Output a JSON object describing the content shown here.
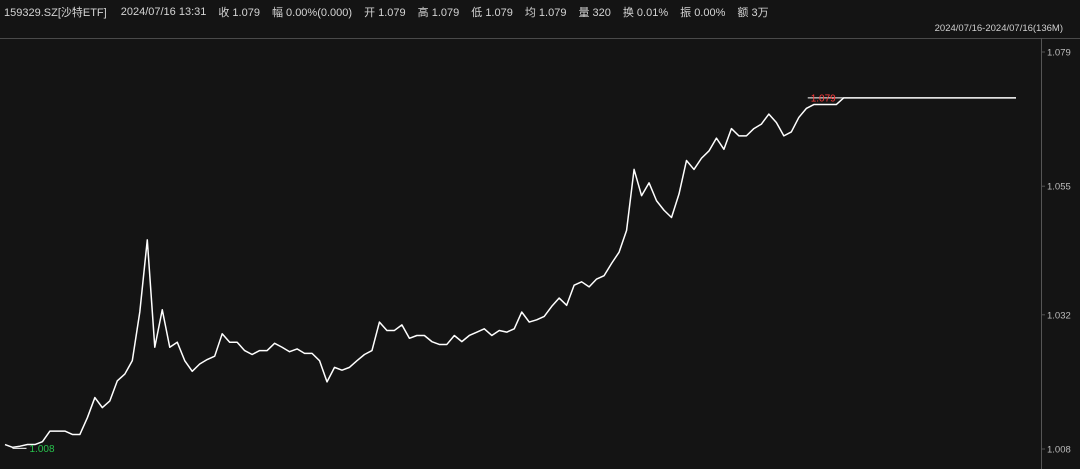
{
  "header": {
    "symbol": "159329.SZ[沙特ETF]",
    "datetime": "2024/07/16 13:31",
    "fields": [
      {
        "label": "收",
        "value": "1.079"
      },
      {
        "label": "幅",
        "value": "0.00%(0.000)"
      },
      {
        "label": "开",
        "value": "1.079"
      },
      {
        "label": "高",
        "value": "1.079"
      },
      {
        "label": "低",
        "value": "1.079"
      },
      {
        "label": "均",
        "value": "1.079"
      },
      {
        "label": "量",
        "value": "320"
      },
      {
        "label": "换",
        "value": "0.01%"
      },
      {
        "label": "振",
        "value": "0.00%"
      },
      {
        "label": "额",
        "value": "3万"
      }
    ],
    "range": "2024/07/16-2024/07/16(136M)"
  },
  "chart_data": {
    "type": "line",
    "title": "",
    "xlabel": "",
    "ylabel": "",
    "ylim": [
      1.008,
      1.079
    ],
    "yticks": [
      "1.079",
      "1.055",
      "1.032",
      "1.008"
    ],
    "grid": false,
    "max_label": {
      "text": "1.079",
      "color": "#ff3b3b"
    },
    "min_label": {
      "text": "1.008",
      "color": "#27c24c"
    },
    "colors": {
      "line": "#ffffff",
      "background": "#141414",
      "axis": "#555555",
      "tick_text": "#bdbdbd"
    },
    "series": [
      {
        "values": [
          1.0088,
          1.0083,
          1.0085,
          1.0088,
          1.0088,
          1.0093,
          1.0112,
          1.0112,
          1.0112,
          1.0106,
          1.0106,
          1.0136,
          1.0172,
          1.0154,
          1.0166,
          1.0202,
          1.0214,
          1.0238,
          1.0325,
          1.0454,
          1.0262,
          1.0329,
          1.0262,
          1.0271,
          1.0238,
          1.0219,
          1.0232,
          1.024,
          1.0246,
          1.0286,
          1.0271,
          1.0271,
          1.0256,
          1.0249,
          1.0256,
          1.0256,
          1.0269,
          1.0262,
          1.0254,
          1.0259,
          1.0251,
          1.0251,
          1.0238,
          1.02,
          1.0226,
          1.0221,
          1.0226,
          1.0238,
          1.0249,
          1.0256,
          1.0307,
          1.0292,
          1.0292,
          1.0302,
          1.0278,
          1.0283,
          1.0283,
          1.0272,
          1.0267,
          1.0267,
          1.0283,
          1.0272,
          1.0283,
          1.0289,
          1.0295,
          1.0283,
          1.0292,
          1.0289,
          1.0295,
          1.0325,
          1.0307,
          1.0311,
          1.0317,
          1.0335,
          1.035,
          1.0337,
          1.0373,
          1.0379,
          1.037,
          1.0384,
          1.039,
          1.0412,
          1.0432,
          1.0471,
          1.058,
          1.0533,
          1.0556,
          1.0524,
          1.0507,
          1.0494,
          1.0536,
          1.0596,
          1.058,
          1.06,
          1.0613,
          1.0636,
          1.0616,
          1.0653,
          1.064,
          1.064,
          1.0653,
          1.0661,
          1.0679,
          1.0664,
          1.064,
          1.0647,
          1.0673,
          1.0689,
          1.0696,
          1.0696,
          1.0696,
          1.0696,
          1.0708,
          1.0708,
          1.0708,
          1.0708,
          1.0708,
          1.0708,
          1.0708,
          1.0708,
          1.0708,
          1.0708,
          1.0708,
          1.0708,
          1.0708,
          1.0708,
          1.0708,
          1.0708,
          1.0708,
          1.0708,
          1.0708,
          1.0708,
          1.0708,
          1.0708,
          1.0708,
          1.0708
        ]
      }
    ]
  }
}
